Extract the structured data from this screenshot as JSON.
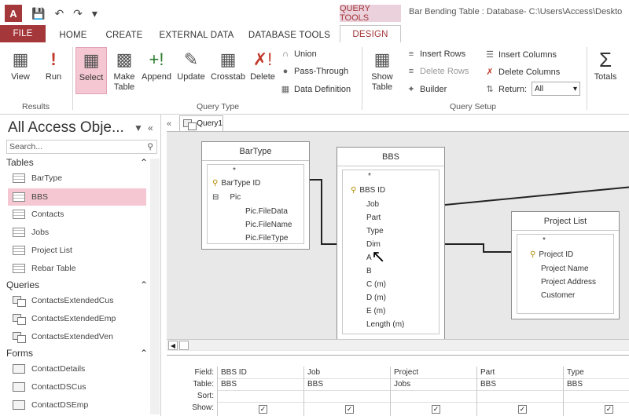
{
  "window": {
    "app_logo": "A",
    "context_tab_header": "QUERY TOOLS",
    "title": "Bar Bending Table : Database- C:\\Users\\Access\\Deskto"
  },
  "tabs": [
    "FILE",
    "HOME",
    "CREATE",
    "EXTERNAL DATA",
    "DATABASE TOOLS",
    "DESIGN"
  ],
  "ribbon": {
    "results": {
      "label": "Results",
      "buttons": [
        "View",
        "Run"
      ]
    },
    "query_type": {
      "label": "Query Type",
      "buttons": [
        "Select",
        "Make Table",
        "Append",
        "Update",
        "Crosstab",
        "Delete"
      ],
      "small": [
        "Union",
        "Pass-Through",
        "Data Definition"
      ]
    },
    "query_setup": {
      "label": "Query Setup",
      "show_table": "Show Table",
      "small_left": [
        "Insert Rows",
        "Delete Rows",
        "Builder"
      ],
      "small_right": [
        "Insert Columns",
        "Delete Columns",
        "Return:"
      ],
      "return_value": "All"
    },
    "totals": "Totals"
  },
  "nav": {
    "title": "All Access Obje...",
    "search_placeholder": "Search...",
    "sections": [
      {
        "name": "Tables",
        "items": [
          "BarType",
          "BBS",
          "Contacts",
          "Jobs",
          "Project List",
          "Rebar Table"
        ]
      },
      {
        "name": "Queries",
        "items": [
          "ContactsExtendedCus",
          "ContactsExtendedEmp",
          "ContactsExtendedVen"
        ]
      },
      {
        "name": "Forms",
        "items": [
          "ContactDetails",
          "ContactDSCus",
          "ContactDSEmp"
        ]
      }
    ],
    "selected_item": "BBS"
  },
  "query": {
    "tab_label": "Query1",
    "tables": [
      {
        "name": "BarType",
        "fields": [
          "*",
          "BarType ID",
          "Pic",
          "Pic.FileData",
          "Pic.FileName",
          "Pic.FileType"
        ]
      },
      {
        "name": "BBS",
        "fields": [
          "*",
          "BBS ID",
          "Job",
          "Part",
          "Type",
          "Dim",
          "A",
          "B",
          "C (m)",
          "D (m)",
          "E (m)",
          "Length (m)"
        ]
      },
      {
        "name": "Project List",
        "fields": [
          "*",
          "Project ID",
          "Project Name",
          "Project Address",
          "Customer"
        ]
      }
    ]
  },
  "grid": {
    "row_labels": [
      "Field:",
      "Table:",
      "Sort:",
      "Show:"
    ],
    "columns": [
      {
        "field": "BBS ID",
        "table": "BBS",
        "show": true
      },
      {
        "field": "Job",
        "table": "BBS",
        "show": true
      },
      {
        "field": "Project",
        "table": "Jobs",
        "show": true
      },
      {
        "field": "Part",
        "table": "BBS",
        "show": true
      },
      {
        "field": "Type",
        "table": "BBS",
        "show": true
      }
    ]
  }
}
